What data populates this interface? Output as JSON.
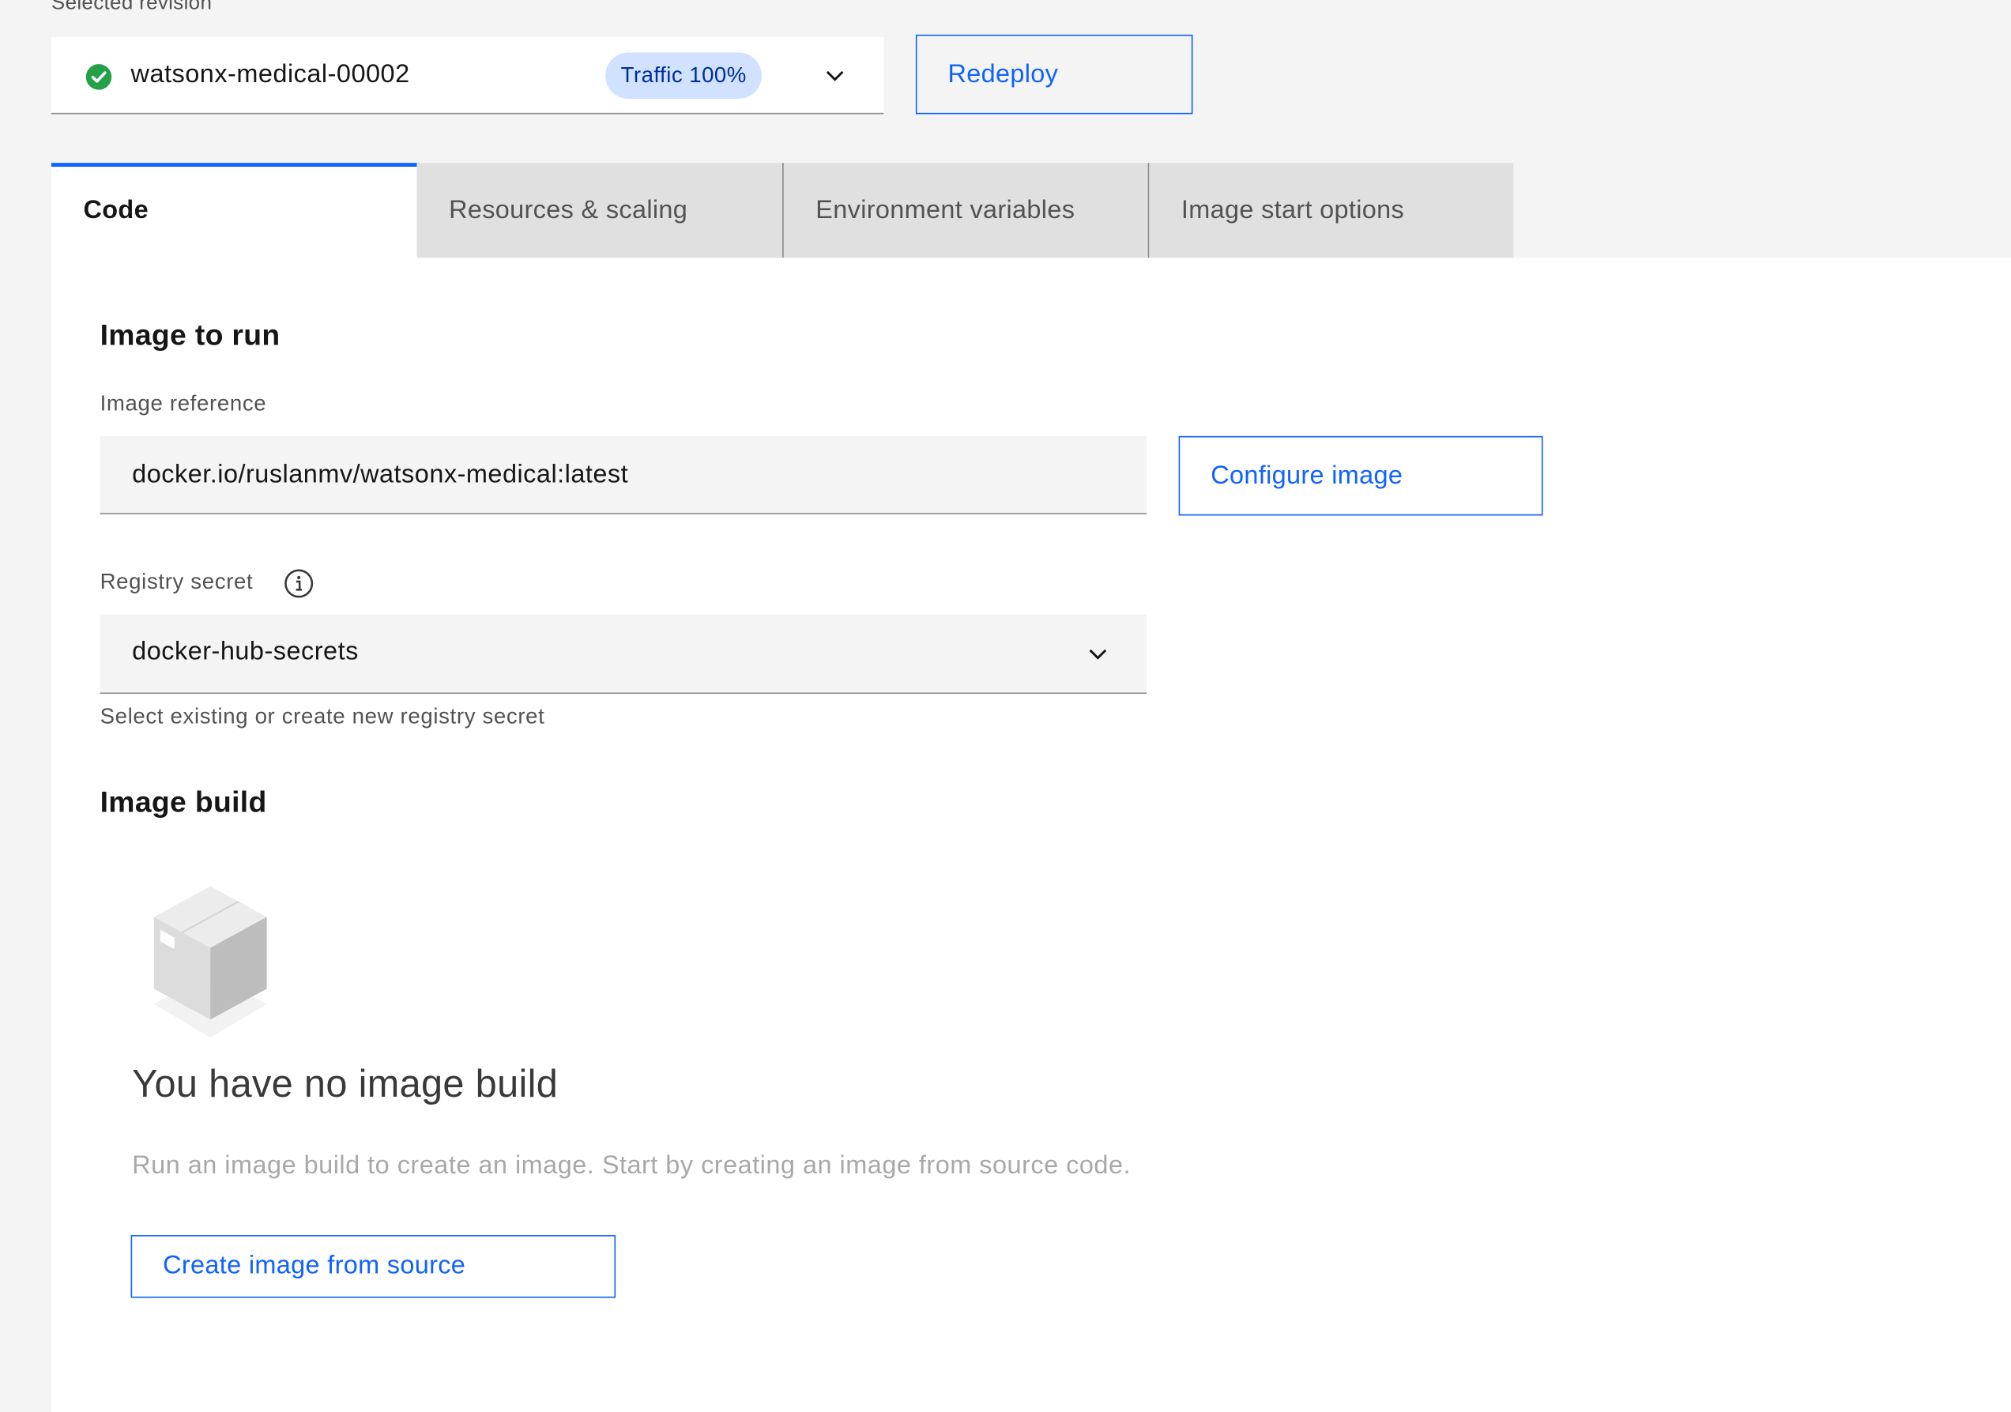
{
  "revision": {
    "label": "Selected revision",
    "name": "watsonx-medical-00002",
    "traffic": "Traffic 100%",
    "status_icon": "checkmark-filled-icon"
  },
  "actions": {
    "redeploy": "Redeploy"
  },
  "tabs": [
    {
      "label": "Code",
      "active": true
    },
    {
      "label": "Resources & scaling",
      "active": false
    },
    {
      "label": "Environment variables",
      "active": false
    },
    {
      "label": "Image start options",
      "active": false
    }
  ],
  "image_to_run": {
    "heading": "Image to run",
    "reference_label": "Image reference",
    "reference_value": "docker.io/ruslanmv/watsonx-medical:latest",
    "configure_button": "Configure image",
    "secret_label": "Registry secret",
    "secret_value": "docker-hub-secrets",
    "secret_helper": "Select existing or create new registry secret"
  },
  "image_build": {
    "heading": "Image build",
    "empty_icon": "box-icon",
    "empty_title": "You have no image build",
    "empty_body": "Run an image build to create an image. Start by creating an image from source code.",
    "create_button": "Create image from source"
  },
  "colors": {
    "accent": "#0f62fe",
    "success": "#24a148",
    "tag_bg": "#d0e2ff",
    "page_bg": "#f4f4f4"
  }
}
